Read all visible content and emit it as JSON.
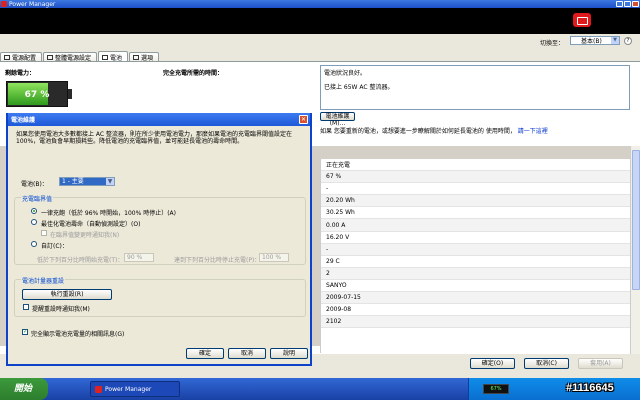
{
  "window": {
    "title": "Power Manager"
  },
  "toolbar": {
    "switch_label": "切換至：",
    "mode_value": "基本(B)"
  },
  "tabs": [
    {
      "label": "電源配置"
    },
    {
      "label": "整體電源設定"
    },
    {
      "label": "電池"
    },
    {
      "label": "選項"
    }
  ],
  "battery": {
    "remaining_label": "剩餘電力：",
    "percent_text": "67 %",
    "level": 0.67,
    "full_charge_time_label": "完全充電所需的時間："
  },
  "status": {
    "line1": "電池狀況良好。",
    "line2": "已接上 65W AC 整流器。"
  },
  "maintenance_button": "電池維護(M)...",
  "tip": {
    "text": "如果 您要重新的電池，或想要進一步瞭解關於如何延長電池的 使用時間，",
    "link": "請一下這裡"
  },
  "values": [
    "正在充電",
    "67 %",
    "-",
    "20.20 Wh",
    "30.25 Wh",
    "0.00 A",
    "16.20 V",
    "-",
    "29 C",
    "2",
    "SANYO",
    "2009-07-15",
    "2009-08",
    "2102"
  ],
  "bottom_buttons": {
    "ok": "確定(O)",
    "cancel": "取消(C)",
    "apply": "套用(A)"
  },
  "dialog": {
    "title": "電池維護",
    "close_glyph": "✕",
    "description": "如果您使用電池大多數都接上 AC 整流器，則在所少使用電池電力，那麼如果電池的充電臨界閾值設定在 100%，電池負會早期損耗些。降低電池的充電臨界值，並可能延長電池的壽命時間。",
    "battery_label": "電池(B)：",
    "battery_value": "1 - 主要",
    "charge_group": "充電臨界值",
    "opt_standard": "一律充飽（低於 96% 時開始，100% 時停止）(A)",
    "opt_optimize": "最佳化電池壽命（自動偵測設定）(O)",
    "opt_optimize_sub": "在臨界值變更時通知我(N)",
    "opt_custom": "自訂(C)：",
    "start_label": "低於下列百分比時開始充電(T)：",
    "start_value": "90 %",
    "stop_label": "達到下列百分比時停止充電(P)：",
    "stop_value": "100 %",
    "gauge_group": "電池計量器重設",
    "reset_button": "執行重設(R)",
    "remind_check": "提醒重設時通知我(M)",
    "show_check": "完全顯示電池充電量的相關訊息(G)",
    "ok": "確定",
    "cancel": "取消",
    "explain": "說明"
  },
  "taskbar": {
    "start_label": "開始",
    "task_label": "Power Manager",
    "tray_battery": "67%",
    "watermark": "#1116645"
  }
}
